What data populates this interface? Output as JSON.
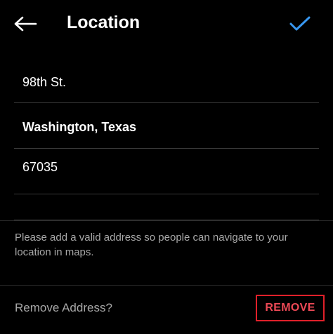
{
  "header": {
    "title": "Location",
    "back_icon": "arrow-left-icon",
    "confirm_icon": "checkmark-icon",
    "confirm_color": "#3897f0"
  },
  "form": {
    "street": "98th St.",
    "city_state": "Washington, Texas",
    "zip": "67035",
    "extra": ""
  },
  "helper_text": "Please add a valid address so people can navigate to your location in maps.",
  "remove": {
    "label": "Remove Address?",
    "button_label": "REMOVE",
    "button_color": "#ed4956"
  }
}
